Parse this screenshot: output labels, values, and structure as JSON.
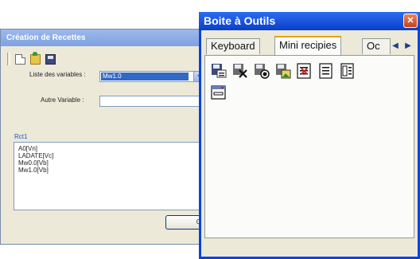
{
  "recettes_window": {
    "title": "Création de Recettes",
    "liste_label": "Liste des variables :",
    "liste_value": "Mw1.0",
    "autre_label": "Autre Variable :",
    "autre_value": "",
    "section_label": "Rct1",
    "list_items": [
      "A0[Vn]",
      "LADATE[Vc]",
      "Mw0.0[Vb]",
      "Mw1.0[Vb]"
    ],
    "ok_label": "OK"
  },
  "toolbox_window": {
    "title": "Boite à Outils",
    "close_glyph": "✕",
    "tabs": [
      "Keyboard",
      "Mini recipies",
      "Oc"
    ],
    "active_tab": "Mini recipies",
    "scroll_left": "◀",
    "scroll_right": "▶"
  }
}
